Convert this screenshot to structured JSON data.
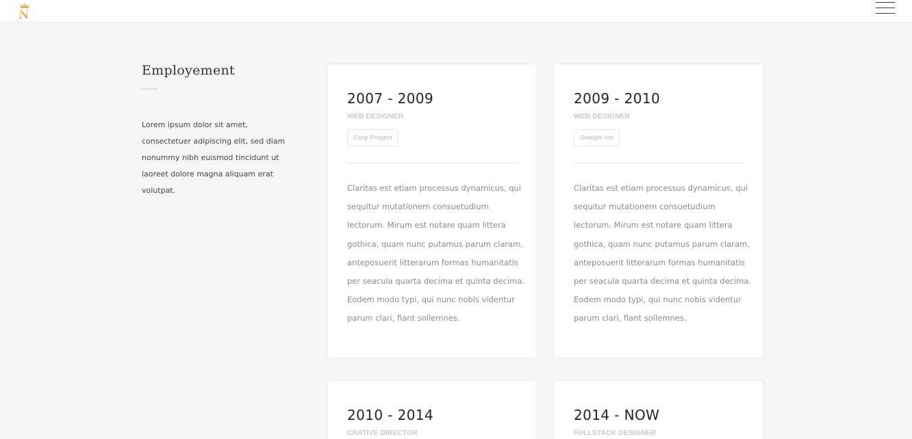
{
  "header": {
    "logo_letter": "N",
    "menu_icon": "hamburger-menu-icon"
  },
  "section": {
    "title": "Employement",
    "description": "Lorem ipsum dolor sit amet, consectetuer adipiscing elit, sed diam nonummy nibh euismod tincidunt ut laoreet dolore magna aliquam erat volutpat."
  },
  "jobs": [
    {
      "years": "2007 - 2009",
      "role": "WEB DESIGNER",
      "company": "Corp Project",
      "description": "Claritas est etiam processus dynamicus, qui sequitur mutationem consuetudium lectorum. Mirum est notare quam littera gothica, quam nunc putamus parum claram, anteposuerit litterarum formas humanitatis per seacula quarta decima et quinta decima. Eodem modo typi, qui nunc nobis videntur parum clari, fiant sollemnes."
    },
    {
      "years": "2009 - 2010",
      "role": "WEB DESIGNER",
      "company": "Google inc",
      "description": "Claritas est etiam processus dynamicus, qui sequitur mutationem consuetudium lectorum. Mirum est notare quam littera gothica, quam nunc putamus parum claram, anteposuerit litterarum formas humanitatis per seacula quarta decima et quinta decima. Eodem modo typi, qui nunc nobis videntur parum clari, fiant sollemnes."
    },
    {
      "years": "2010 - 2014",
      "role": "CRATIVE DIRECTOR"
    },
    {
      "years": "2014 - NOW",
      "role": "FULLSTACK DESIGNER"
    }
  ]
}
